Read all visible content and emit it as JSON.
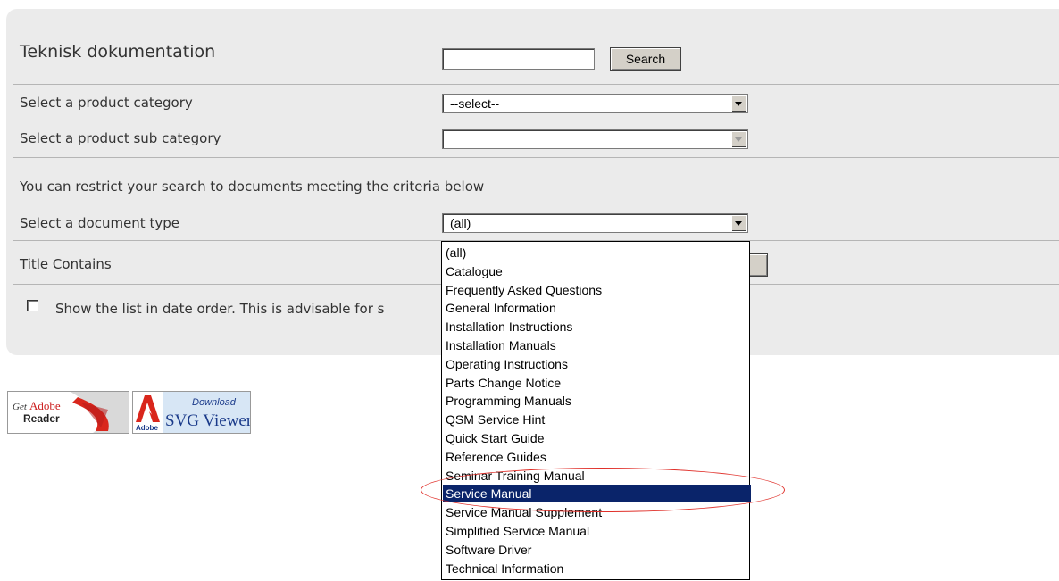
{
  "page": {
    "title": "Teknisk dokumentation",
    "search": {
      "value": "",
      "button_label": "Search"
    },
    "category": {
      "label": "Select a product category",
      "value": "--select--"
    },
    "subcategory": {
      "label": "Select a product sub category",
      "value": ""
    },
    "restrict_text": "You can restrict your search to documents meeting the criteria below",
    "doctype": {
      "label": "Select a document type",
      "value": "(all)"
    },
    "title_contains": {
      "label": "Title Contains"
    },
    "date_order": {
      "label": "Show the list in date order. This is advisable for s",
      "checked": false
    },
    "dropdown": {
      "options": [
        "(all)",
        "Catalogue",
        "Frequently Asked Questions",
        "General Information",
        "Installation Instructions",
        "Installation Manuals",
        "Operating Instructions",
        "Parts Change Notice",
        "Programming Manuals",
        "QSM Service Hint",
        "Quick Start Guide",
        "Reference Guides",
        "Seminar Training Manual",
        "Service Manual",
        "Service Manual Supplement",
        "Simplified Service Manual",
        "Software Driver",
        "Technical Information"
      ],
      "selected_index": 13
    },
    "badges": {
      "reader": {
        "get": "Get",
        "brand": "Adobe",
        "product": "Reader"
      },
      "svg": {
        "brand": "Adobe",
        "download": "Download",
        "product": "SVG Viewer"
      }
    },
    "colors": {
      "highlight": "#0a246a",
      "annotation": "#e0302a",
      "panel": "#ebebeb"
    }
  }
}
